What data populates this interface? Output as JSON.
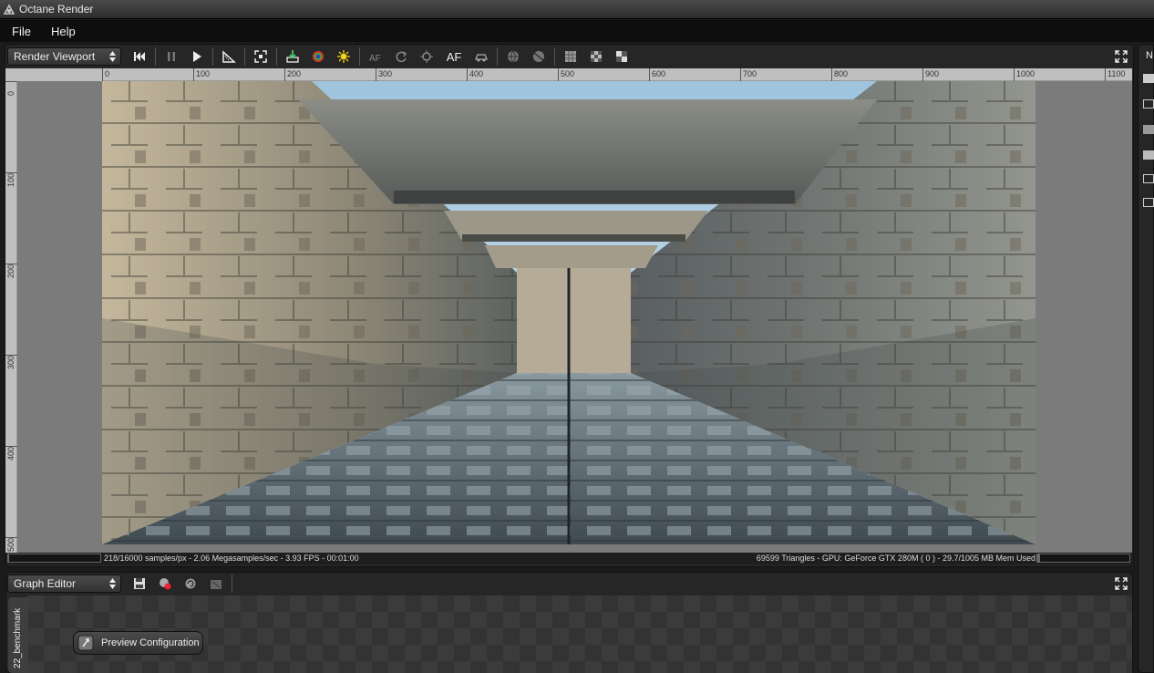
{
  "window": {
    "title": "Octane Render"
  },
  "menu": [
    {
      "label": "File"
    },
    {
      "label": "Help"
    }
  ],
  "viewport": {
    "selector_label": "Render Viewport",
    "toolbar": {
      "af_label": "AF"
    },
    "ruler": {
      "h_ticks": [
        "0",
        "100",
        "200",
        "300",
        "400",
        "500",
        "600",
        "700",
        "800",
        "900",
        "1000",
        "1100"
      ],
      "v_ticks": [
        "0",
        "100",
        "200",
        "300",
        "400",
        "500"
      ]
    },
    "status_left": "218/16000 samples/px - 2.06 Megasamples/sec - 3.93 FPS - 00:01:00",
    "status_right": "69599 Triangles - GPU: GeForce GTX 280M ( 0 ) - 29.7/1005 MB Mem Used"
  },
  "graph_editor": {
    "selector_label": "Graph Editor",
    "side_tab": "22_benchmark",
    "node_label": "Preview Configuration"
  },
  "right_panel": {
    "header_label": "N"
  },
  "colors": {
    "sky": "#a8c8dc",
    "stone_light": "#b9ae97",
    "stone_dark": "#4a5358"
  }
}
